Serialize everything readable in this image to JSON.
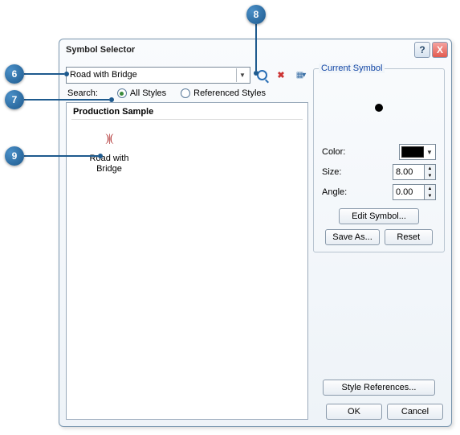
{
  "dialog": {
    "title": "Symbol Selector",
    "help_tooltip": "?",
    "close_tooltip": "X"
  },
  "search": {
    "value": "Road with Bridge",
    "label": "Search:"
  },
  "radios": {
    "all_styles": "All Styles",
    "referenced_styles": "Referenced Styles",
    "selected": "all_styles"
  },
  "results": {
    "category": "Production Sample",
    "items": [
      {
        "label": "Road with Bridge",
        "glyph": ")|("
      }
    ]
  },
  "current_symbol": {
    "group_title": "Current Symbol",
    "color_label": "Color:",
    "size_label": "Size:",
    "size_value": "8.00",
    "angle_label": "Angle:",
    "angle_value": "0.00",
    "edit_symbol": "Edit Symbol...",
    "save_as": "Save As...",
    "reset": "Reset"
  },
  "footer": {
    "style_references": "Style References...",
    "ok": "OK",
    "cancel": "Cancel"
  },
  "callouts": {
    "c6": "6",
    "c7": "7",
    "c8": "8",
    "c9": "9"
  },
  "icons": {
    "search": "search-icon",
    "clear_search": "clear-search-icon",
    "view_mode": "view-mode-icon"
  }
}
